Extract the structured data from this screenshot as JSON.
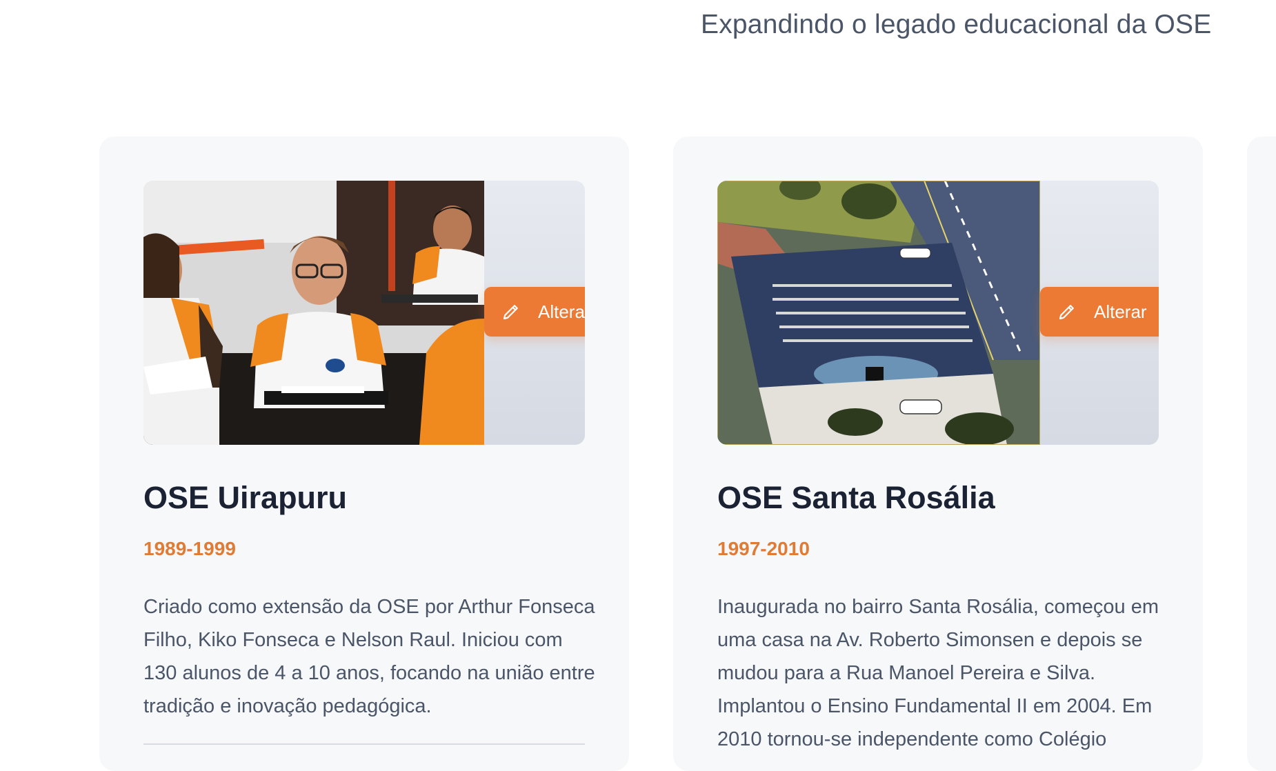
{
  "header": {
    "subtitle": "Expandindo o legado educacional da OSE"
  },
  "cards": [
    {
      "title": "OSE Uirapuru",
      "years": "1989-1999",
      "description": "Criado como extensão da OSE por Arthur Fonseca Filho, Kiko Fonseca e Nelson Raul. Iniciou com 130 alunos de 4 a 10 anos, focando na união entre tradição e inovação pedagógica.",
      "edit_label": "Alterar",
      "image_alt": "Aluno com uniforme laranja e branco fazendo prova em sala de aula"
    },
    {
      "title": "OSE Santa Rosália",
      "years": "1997-2010",
      "description": "Inaugurada no bairro Santa Rosália, começou em uma casa na Av. Roberto Simonsen e depois se mudou para a Rua Manoel Pereira e Silva. Implantou o Ensino Fundamental II em 2004. Em 2010 tornou-se independente como Colégio",
      "edit_label": "Alterar",
      "image_alt": "Vista aérea da escola com quadra cheia de pessoas"
    }
  ],
  "colors": {
    "accent": "#ec7a35",
    "years": "#e07b35",
    "title": "#1a2233",
    "body_text": "#4a5568",
    "card_bg": "#f7f8fa"
  },
  "icons": {
    "edit": "pencil-icon"
  }
}
